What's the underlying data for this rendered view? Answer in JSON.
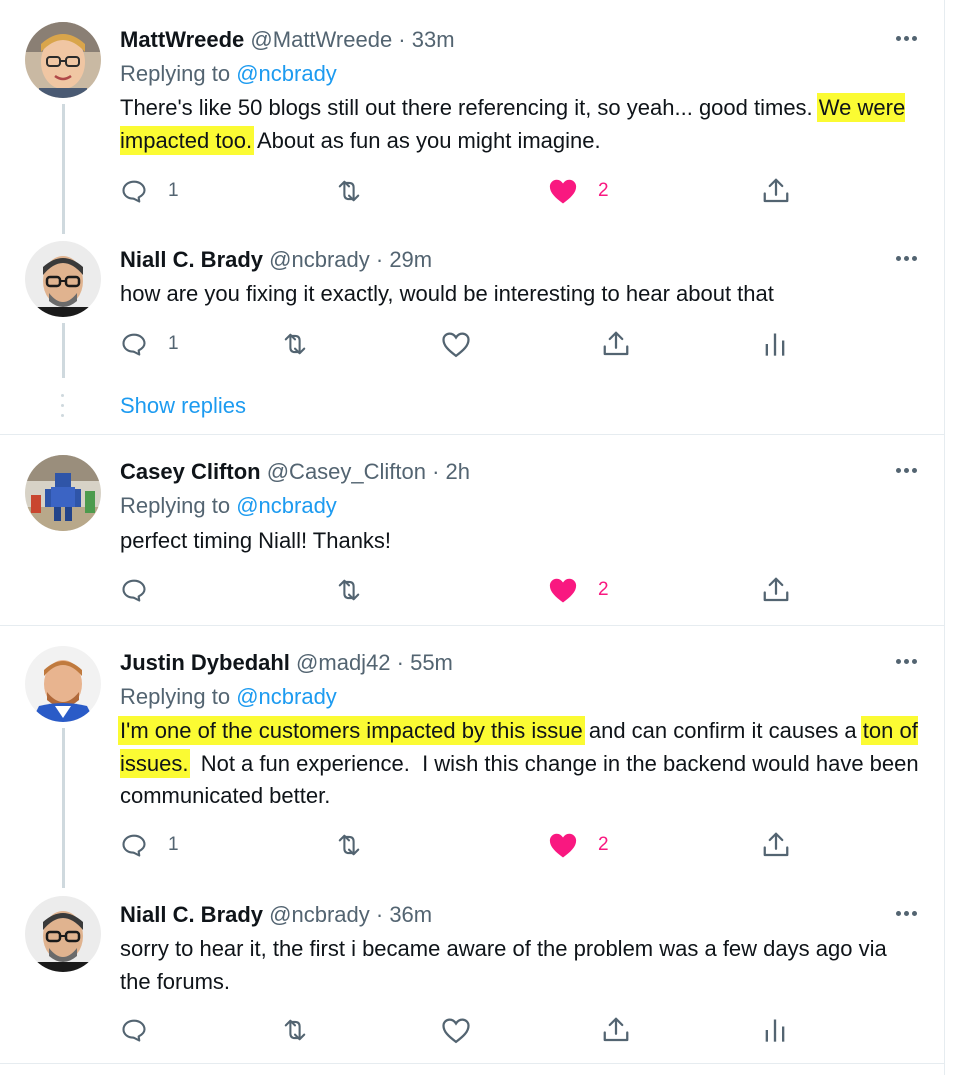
{
  "tweets": [
    {
      "name": "MattWreede",
      "meta": "@MattWreede · 33m",
      "replying_prefix": "Replying to",
      "replying_handle": "@ncbrady",
      "text_parts": [
        "There's like 50 blogs still out there referencing it, so yeah... good times. ",
        "We were impacted too.",
        " About as fun as you might imagine."
      ],
      "reply_count": "1",
      "like_count": "2",
      "liked": true
    },
    {
      "name": "Niall C. Brady",
      "meta": "@ncbrady · 29m",
      "text": "how are you fixing it exactly, would be interesting to hear about that",
      "reply_count": "1"
    },
    {
      "name": "Casey Clifton",
      "meta": "@Casey_Clifton · 2h",
      "replying_prefix": "Replying to",
      "replying_handle": "@ncbrady",
      "text": "perfect timing Niall! Thanks!",
      "like_count": "2",
      "liked": true
    },
    {
      "name": "Justin Dybedahl",
      "meta": "@madj42 · 55m",
      "replying_prefix": "Replying to",
      "replying_handle": "@ncbrady",
      "text_parts": [
        "I'm one of the customers impacted by this issue",
        " and can confirm it causes a ",
        "ton of issues.",
        "  Not a fun experience.  I wish this change in the backend would have been communicated better."
      ],
      "reply_count": "1",
      "like_count": "2",
      "liked": true
    },
    {
      "name": "Niall C. Brady",
      "meta": "@ncbrady · 36m",
      "text": "sorry to hear it, the first i became aware of the problem was a few days ago via the forums."
    }
  ],
  "show_replies_label": "Show replies",
  "colors": {
    "link": "#1d9bf0",
    "like": "#f91880",
    "muted": "#536471",
    "highlight": "#fbfb33"
  }
}
